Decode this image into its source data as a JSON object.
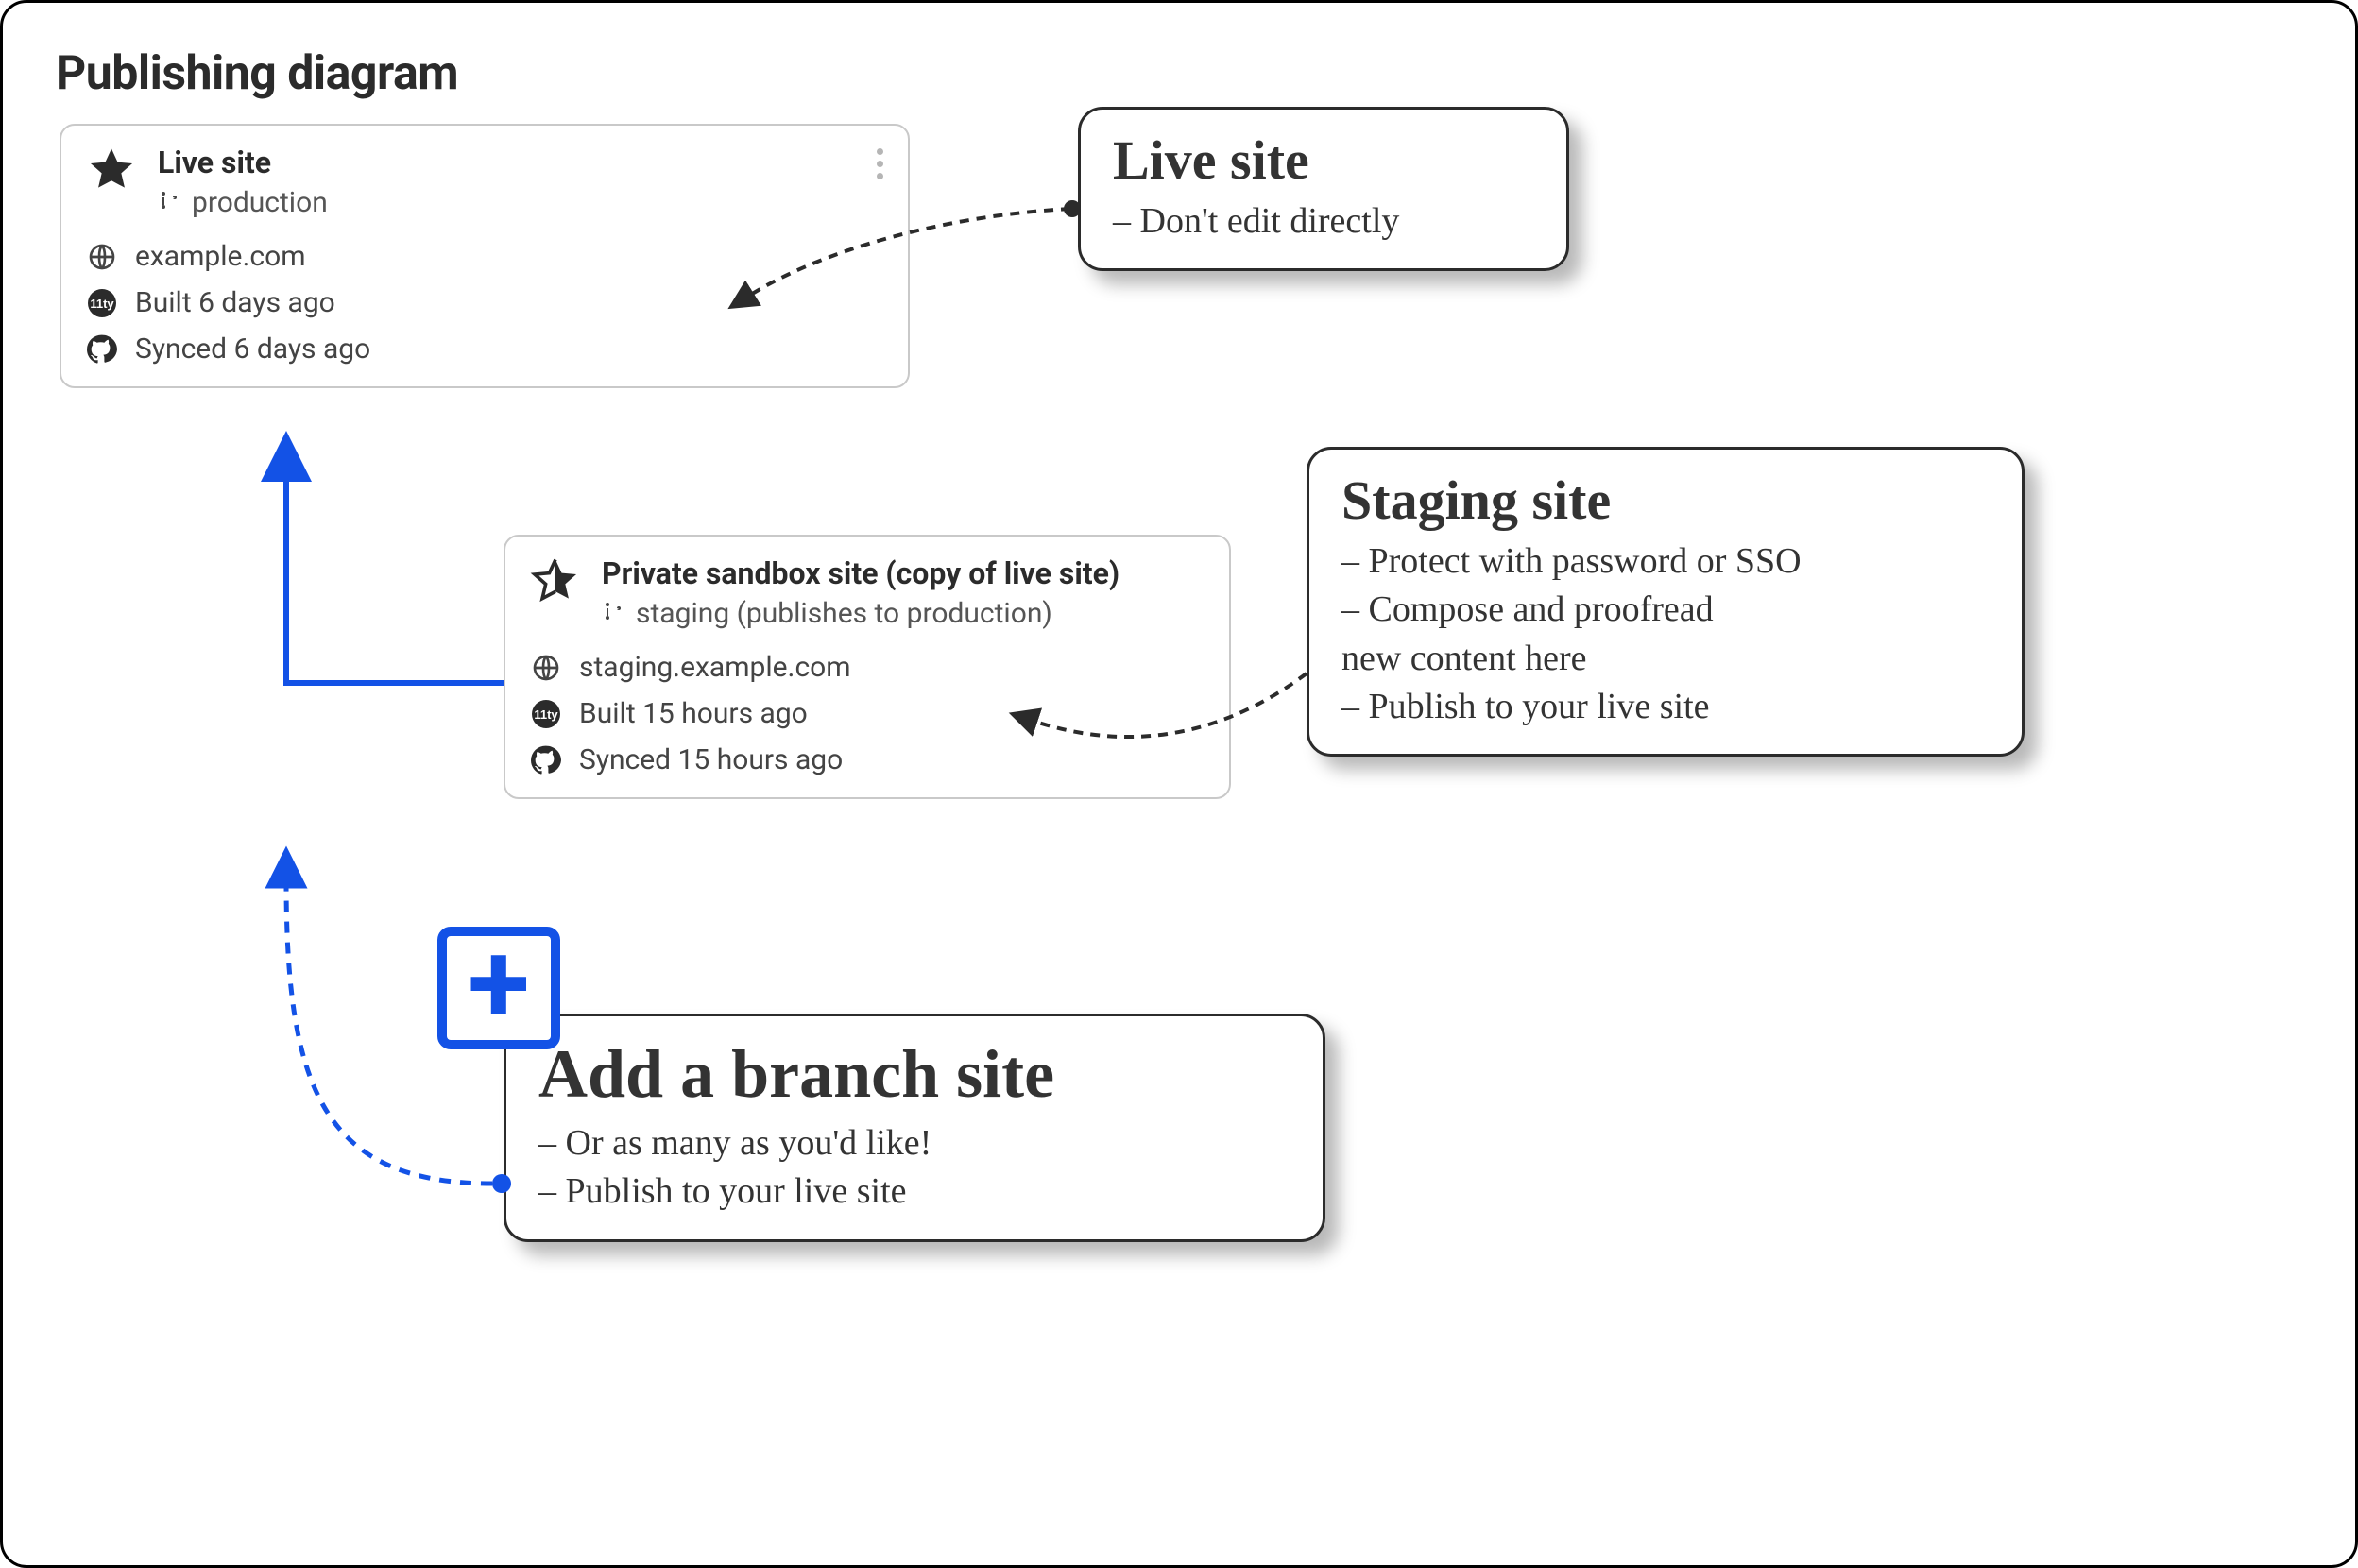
{
  "title": "Publishing diagram",
  "live_card": {
    "name": "Live site",
    "branch": "production",
    "domain": "example.com",
    "build": "Built 6 days ago",
    "sync": "Synced 6 days ago"
  },
  "staging_card": {
    "name": "Private sandbox site (copy of live site)",
    "branch": "staging (publishes to production)",
    "domain": "staging.example.com",
    "build": "Built 15 hours ago",
    "sync": "Synced 15 hours ago"
  },
  "note_live": {
    "title": "Live site",
    "line1": "Don't edit directly"
  },
  "note_staging": {
    "title": "Staging site",
    "line1": "Protect with password or SSO",
    "line2a": "Compose and proofread",
    "line2b": "new content here",
    "line3": "Publish to your live site"
  },
  "note_branch": {
    "title": "Add a branch site",
    "line1": "Or as many as you'd like!",
    "line2": "Publish to your live site"
  },
  "icons": {
    "star_full": "star-icon",
    "star_half": "half-star-icon",
    "branch": "branch-icon",
    "globe": "globe-icon",
    "build": "eleventy-icon",
    "sync": "github-icon",
    "kebab": "kebab-icon",
    "plus": "plus-icon"
  }
}
